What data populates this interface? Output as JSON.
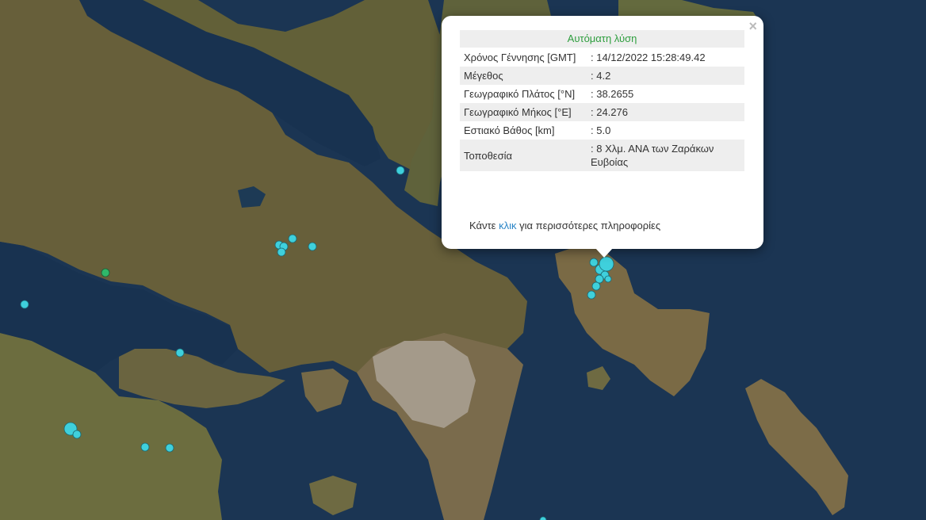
{
  "map": {
    "colors": {
      "sea": "#1b3553",
      "land": "#6b6a3c",
      "city": "#a49a8a",
      "marker": "#3fd0dc",
      "marker_green": "#2fb86a"
    },
    "markers": [
      {
        "id": "m1",
        "color": "cyan"
      },
      {
        "id": "m2",
        "color": "cyan"
      },
      {
        "id": "m3",
        "color": "cyan"
      },
      {
        "id": "m4",
        "color": "cyan"
      },
      {
        "id": "m5",
        "color": "cyan"
      },
      {
        "id": "m6",
        "color": "green"
      },
      {
        "id": "m7",
        "color": "cyan"
      },
      {
        "id": "m8",
        "color": "cyan"
      },
      {
        "id": "m9",
        "color": "cyan"
      },
      {
        "id": "m10",
        "color": "cyan"
      },
      {
        "id": "m11",
        "color": "cyan"
      },
      {
        "id": "m12",
        "color": "cyan"
      },
      {
        "id": "selected",
        "color": "cyan"
      }
    ]
  },
  "popup": {
    "close_glyph": "×",
    "title": "Αυτόματη λύση",
    "rows": [
      {
        "label": "Χρόνος Γέννησης [GMT]",
        "value": ": 14/12/2022 15:28:49.42"
      },
      {
        "label": "Μέγεθος",
        "value": ": 4.2"
      },
      {
        "label": "Γεωγραφικό Πλάτος [°N]",
        "value": ": 38.2655"
      },
      {
        "label": "Γεωγραφικό Μήκος [°E]",
        "value": ": 24.276"
      },
      {
        "label": "Εστιακό Βάθος [km]",
        "value": ": 5.0"
      },
      {
        "label": "Τοποθεσία",
        "value": ": 8 Χλμ. ΑΝΑ των Ζαράκων Ευβοίας"
      }
    ],
    "more_prefix": "Κάντε",
    "more_link": "κλικ",
    "more_suffix": "για περισσότερες πληροφορίες"
  }
}
